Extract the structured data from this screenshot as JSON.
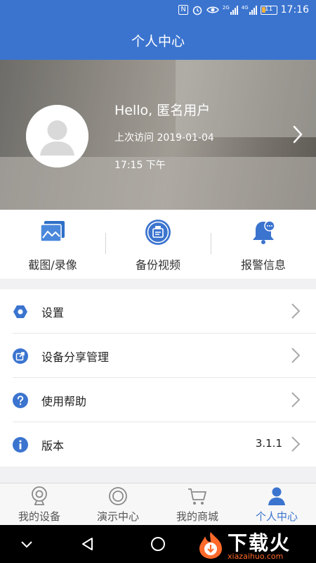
{
  "status_bar": {
    "nfc_icon": "N",
    "battery_level": "11",
    "time": "17:16",
    "signal_label_1": "2G",
    "signal_label_2": "4G"
  },
  "title": "个人中心",
  "profile": {
    "greeting": "Hello, 匿名用户",
    "last_visit_date": "上次访问 2019-01-04",
    "last_visit_time": "17:15 下午"
  },
  "quick_actions": [
    {
      "label": "截图/录像",
      "icon": "screenshot-video-icon"
    },
    {
      "label": "备份视频",
      "icon": "backup-video-icon"
    },
    {
      "label": "报警信息",
      "icon": "alarm-bell-icon"
    }
  ],
  "menu": [
    {
      "label": "设置",
      "icon": "settings-hex-icon",
      "value": ""
    },
    {
      "label": "设备分享管理",
      "icon": "share-icon",
      "value": ""
    },
    {
      "label": "使用帮助",
      "icon": "help-icon",
      "value": ""
    },
    {
      "label": "版本",
      "icon": "info-icon",
      "value": "3.1.1"
    }
  ],
  "tabs": [
    {
      "label": "我的设备",
      "icon": "camera-device-icon",
      "active": false
    },
    {
      "label": "演示中心",
      "icon": "lens-icon",
      "active": false
    },
    {
      "label": "我的商城",
      "icon": "cart-icon",
      "active": false
    },
    {
      "label": "个人中心",
      "icon": "person-icon",
      "active": true
    }
  ],
  "watermark": {
    "text": "下载火",
    "url": "xiazaihuo.com"
  },
  "colors": {
    "brand_blue": "#3b74cf",
    "active_tab": "#3b74cf",
    "watermark_orange": "#ff6a2a"
  }
}
